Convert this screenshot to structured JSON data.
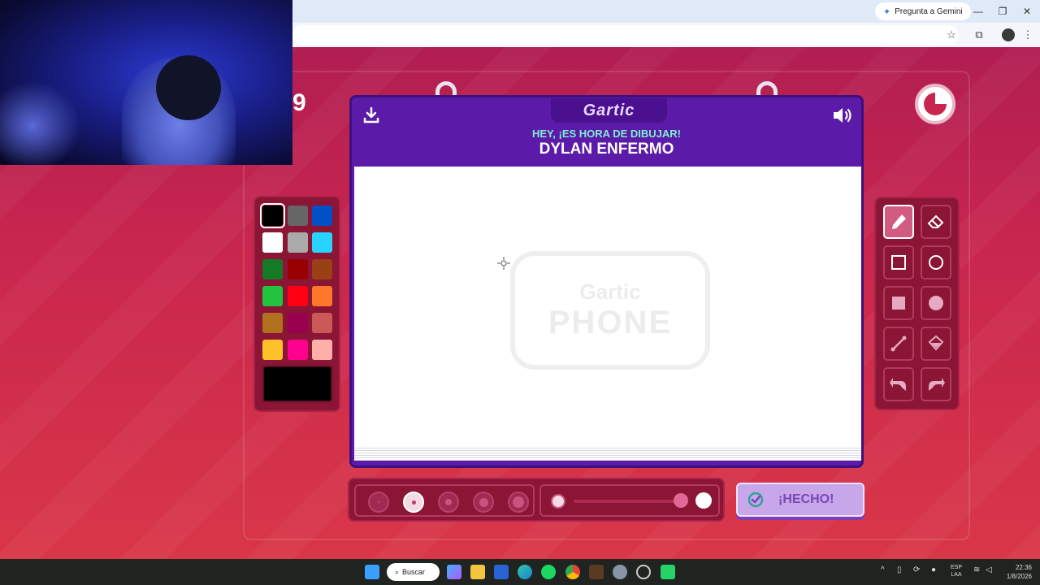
{
  "browser": {
    "gemini_label": "Pregunta a Gemini",
    "minimize_glyph": "—",
    "maximize_glyph": "❐",
    "close_glyph": "✕",
    "bookmark_glyph": "☆",
    "extensions_glyph": "⧉",
    "menu_glyph": "⋮"
  },
  "game": {
    "round_number": "9",
    "logo": "Gartic",
    "subtitle": "HEY, ¡ES HORA DE DIBUJAR!",
    "phrase": "DYLAN ENFERMO",
    "watermark_top": "Gartic",
    "watermark_bottom": "PHONE",
    "done_label": "¡HECHO!",
    "timer_fraction_remaining": 0.75,
    "opacity_value": 0.94
  },
  "palette": {
    "colors": [
      "#000000",
      "#666666",
      "#0050c8",
      "#ffffff",
      "#aaaaaa",
      "#27d4ff",
      "#157a25",
      "#990000",
      "#994114",
      "#22c33e",
      "#ff0013",
      "#ff7829",
      "#b0701e",
      "#990050",
      "#cb5a57",
      "#ffc12a",
      "#ff008f",
      "#feafa8"
    ],
    "selected_index": 0,
    "current_color": "#000000"
  },
  "tools": [
    {
      "name": "pencil-tool",
      "icon": "pencil-icon",
      "active": true
    },
    {
      "name": "eraser-tool",
      "icon": "eraser-icon",
      "active": false
    },
    {
      "name": "rectangle-outline-tool",
      "icon": "square-outline-icon",
      "active": false
    },
    {
      "name": "ellipse-outline-tool",
      "icon": "circle-outline-icon",
      "active": false
    },
    {
      "name": "rectangle-fill-tool",
      "icon": "square-fill-icon",
      "active": false
    },
    {
      "name": "ellipse-fill-tool",
      "icon": "circle-fill-icon",
      "active": false
    },
    {
      "name": "line-tool",
      "icon": "line-icon",
      "active": false
    },
    {
      "name": "bucket-tool",
      "icon": "bucket-icon",
      "active": false
    },
    {
      "name": "undo-tool",
      "icon": "undo-icon",
      "active": false
    },
    {
      "name": "redo-tool",
      "icon": "redo-icon",
      "active": false
    }
  ],
  "brush_sizes": [
    {
      "size": 2,
      "active": false
    },
    {
      "size": 5,
      "active": true
    },
    {
      "size": 8,
      "active": false
    },
    {
      "size": 11,
      "active": false
    },
    {
      "size": 14,
      "active": false
    }
  ],
  "taskbar": {
    "search_label": "Buscar",
    "lang_line1": "ESP",
    "lang_line2": "LAA",
    "time": "22:36",
    "date": "1/8/2026"
  }
}
